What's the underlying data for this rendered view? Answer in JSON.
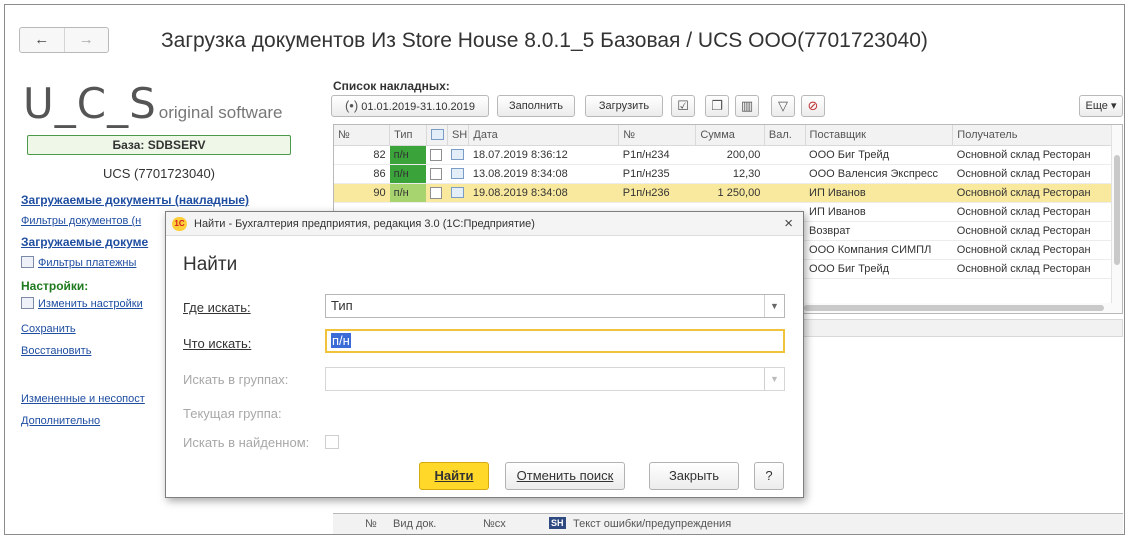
{
  "header": {
    "back_icon": "←",
    "forward_icon": "→",
    "title": "Загрузка документов Из Store House 8.0.1_5 Базовая   / UCS ООО(7701723040)"
  },
  "left": {
    "logo_main": "U_C_S",
    "logo_sub": "original software",
    "base": "База: SDBSERV",
    "company": "UCS (7701723040)",
    "link_docs": "Загружаемые документы (накладные)",
    "link_doc_filters": "Фильтры документов (н",
    "link_docs2": "Загружаемые докуме",
    "link_payment_filters": "Фильтры платежны",
    "settings_header": "Настройки:",
    "link_change_settings": "Изменить настройки",
    "link_save": "Сохранить",
    "link_restore": "Восстановить",
    "link_changed": "Измененные и несопост",
    "link_more": "Дополнительно"
  },
  "list": {
    "label": "Список накладных:",
    "period": "01.01.2019-31.10.2019",
    "fill_button": "Заполнить",
    "load_button": "Загрузить",
    "more_button": "Еще ▾",
    "columns": [
      "№",
      "Тип",
      "",
      "SH",
      "Дата",
      "№",
      "Сумма",
      "Вал.",
      "Поставщик",
      "Получатель"
    ],
    "rows": [
      {
        "num": "82",
        "type": "п/н",
        "date": "18.07.2019 8:36:12",
        "docno": "Р1п/н234",
        "sum": "200,00",
        "cur": "",
        "supplier": "ООО Биг Трейд",
        "receiver": "Основной склад Ресторан"
      },
      {
        "num": "86",
        "type": "п/н",
        "date": "13.08.2019 8:34:08",
        "docno": "Р1п/н235",
        "sum": "12,30",
        "cur": "",
        "supplier": "ООО Валенсия Экспресс",
        "receiver": "Основной склад Ресторан"
      },
      {
        "num": "90",
        "type": "п/н",
        "date": "19.08.2019 8:34:08",
        "docno": "Р1п/н236",
        "sum": "1 250,00",
        "cur": "",
        "supplier": "ИП Иванов",
        "receiver": "Основной склад Ресторан"
      },
      {
        "num": "",
        "type": "",
        "date": "",
        "docno": "",
        "sum": "",
        "cur": "",
        "supplier": "ИП Иванов",
        "receiver": "Основной склад Ресторан"
      },
      {
        "num": "",
        "type": "",
        "date": "",
        "docno": "",
        "sum": "",
        "cur": "",
        "supplier": "Возврат",
        "receiver": "Основной склад Ресторан"
      },
      {
        "num": "",
        "type": "",
        "date": "",
        "docno": "",
        "sum": "",
        "cur": "",
        "supplier": "ООО Компания СИМПЛ",
        "receiver": "Основной склад Ресторан"
      },
      {
        "num": "",
        "type": "",
        "date": "",
        "docno": "",
        "sum": "",
        "cur": "",
        "supplier": "ООО Биг Трейд",
        "receiver": "Основной склад Ресторан"
      }
    ]
  },
  "bottom": {
    "col_num": "№",
    "col_doc_type": "Вид док.",
    "col_no_sh": "№сх",
    "col_sh_icon": "SH",
    "col_error": "Текст ошибки/предупреждения"
  },
  "dialog": {
    "window_title": "Найти - Бухгалтерия предприятия, редакция 3.0 (1С:Предприятие)",
    "logo": "1С",
    "close": "×",
    "heading": "Найти",
    "where_label": "Где искать:",
    "where_value": "Тип",
    "what_label": "Что искать:",
    "what_value": "п/н",
    "groups_label": "Искать в группах:",
    "current_group_label": "Текущая группа:",
    "in_found_label": "Искать в найденном:",
    "find_button": "Найти",
    "cancel_button": "Отменить поиск",
    "close_button": "Закрыть",
    "help_button": "?"
  },
  "colors": {
    "accent_yellow": "#ffd82a",
    "selection_row": "#f9e99e",
    "type_green": "#3aa33a",
    "link_blue": "#1f4ea1"
  }
}
